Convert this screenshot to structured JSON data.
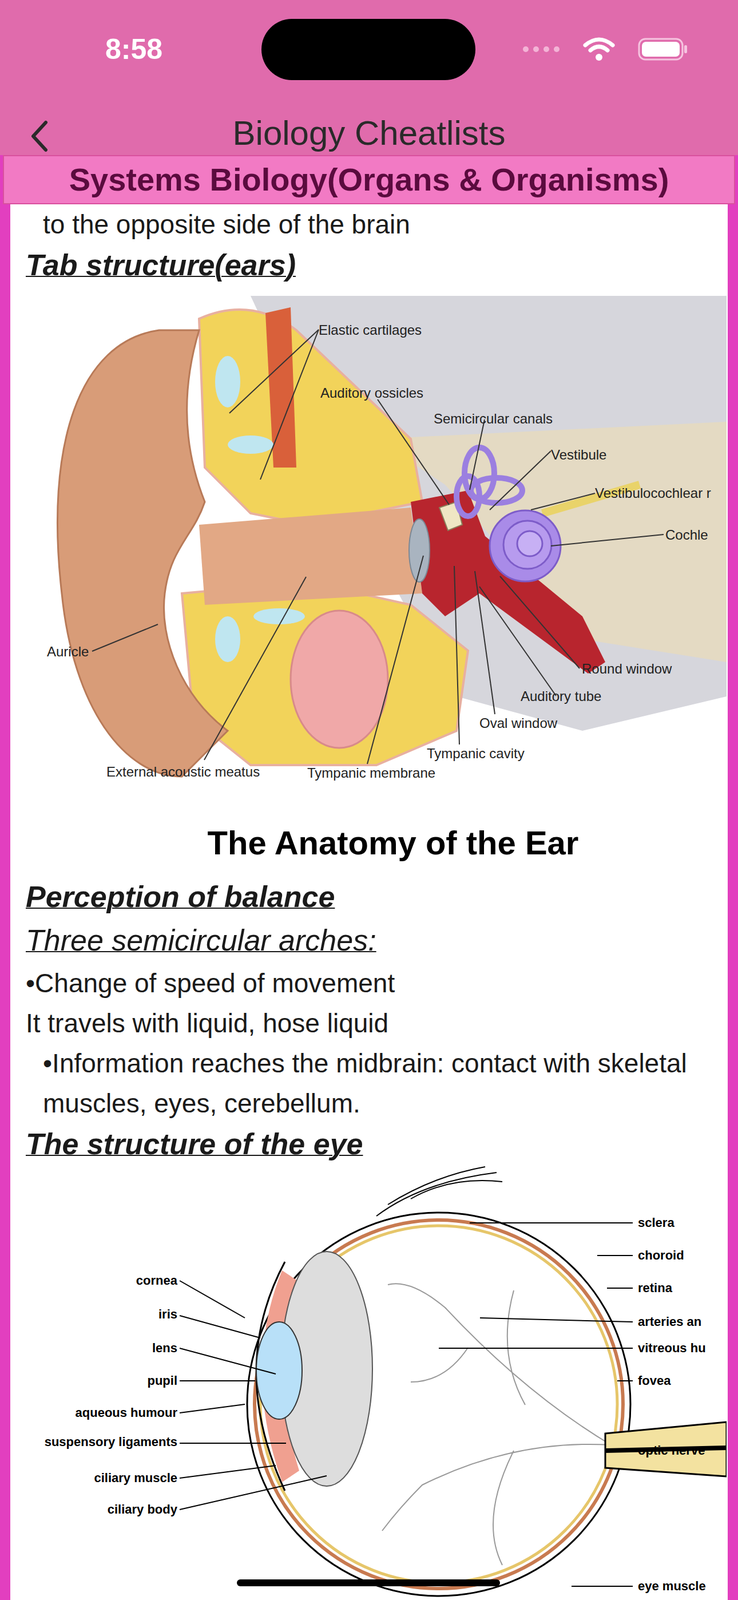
{
  "status_bar": {
    "time": "8:58"
  },
  "nav": {
    "title": "Biology Cheatlists"
  },
  "banner": {
    "title": "Systems Biology(Organs & Organisms)"
  },
  "content": {
    "intro": "to the opposite side of the brain",
    "ear_section": {
      "heading": "Tab structure(ears)",
      "figure": {
        "caption": "The Anatomy of the Ear",
        "labels": [
          "Elastic cartilages",
          "Auditory ossicles",
          "Semicircular canals",
          "Vestibule",
          "Vestibulocochlear r",
          "Cochle",
          "Round window",
          "Auditory tube",
          "Oval window",
          "Tympanic cavity",
          "Tympanic membrane",
          "External acoustic meatus",
          "Auricle"
        ]
      }
    },
    "balance_section": {
      "heading": "Perception of balance",
      "subheading": "Three semicircular arches:",
      "lines": [
        {
          "text": "•Change of speed of movement",
          "kind": "plain"
        },
        {
          "text": "It travels with liquid, hose liquid",
          "kind": "plain"
        },
        {
          "text": "•Information reaches the midbrain: contact with skeletal muscles, eyes, cerebellum.",
          "kind": "indented"
        }
      ]
    },
    "eye_section": {
      "heading": "The structure of the eye",
      "figure": {
        "labels": [
          "cornea",
          "iris",
          "lens",
          "pupil",
          "aqueous humour",
          "suspensory ligaments",
          "ciliary muscle",
          "ciliary body",
          "sclera",
          "choroid",
          "retina",
          "arteries an",
          "vitreous hu",
          "fovea",
          "optic nerve",
          "eye muscle"
        ]
      }
    }
  }
}
